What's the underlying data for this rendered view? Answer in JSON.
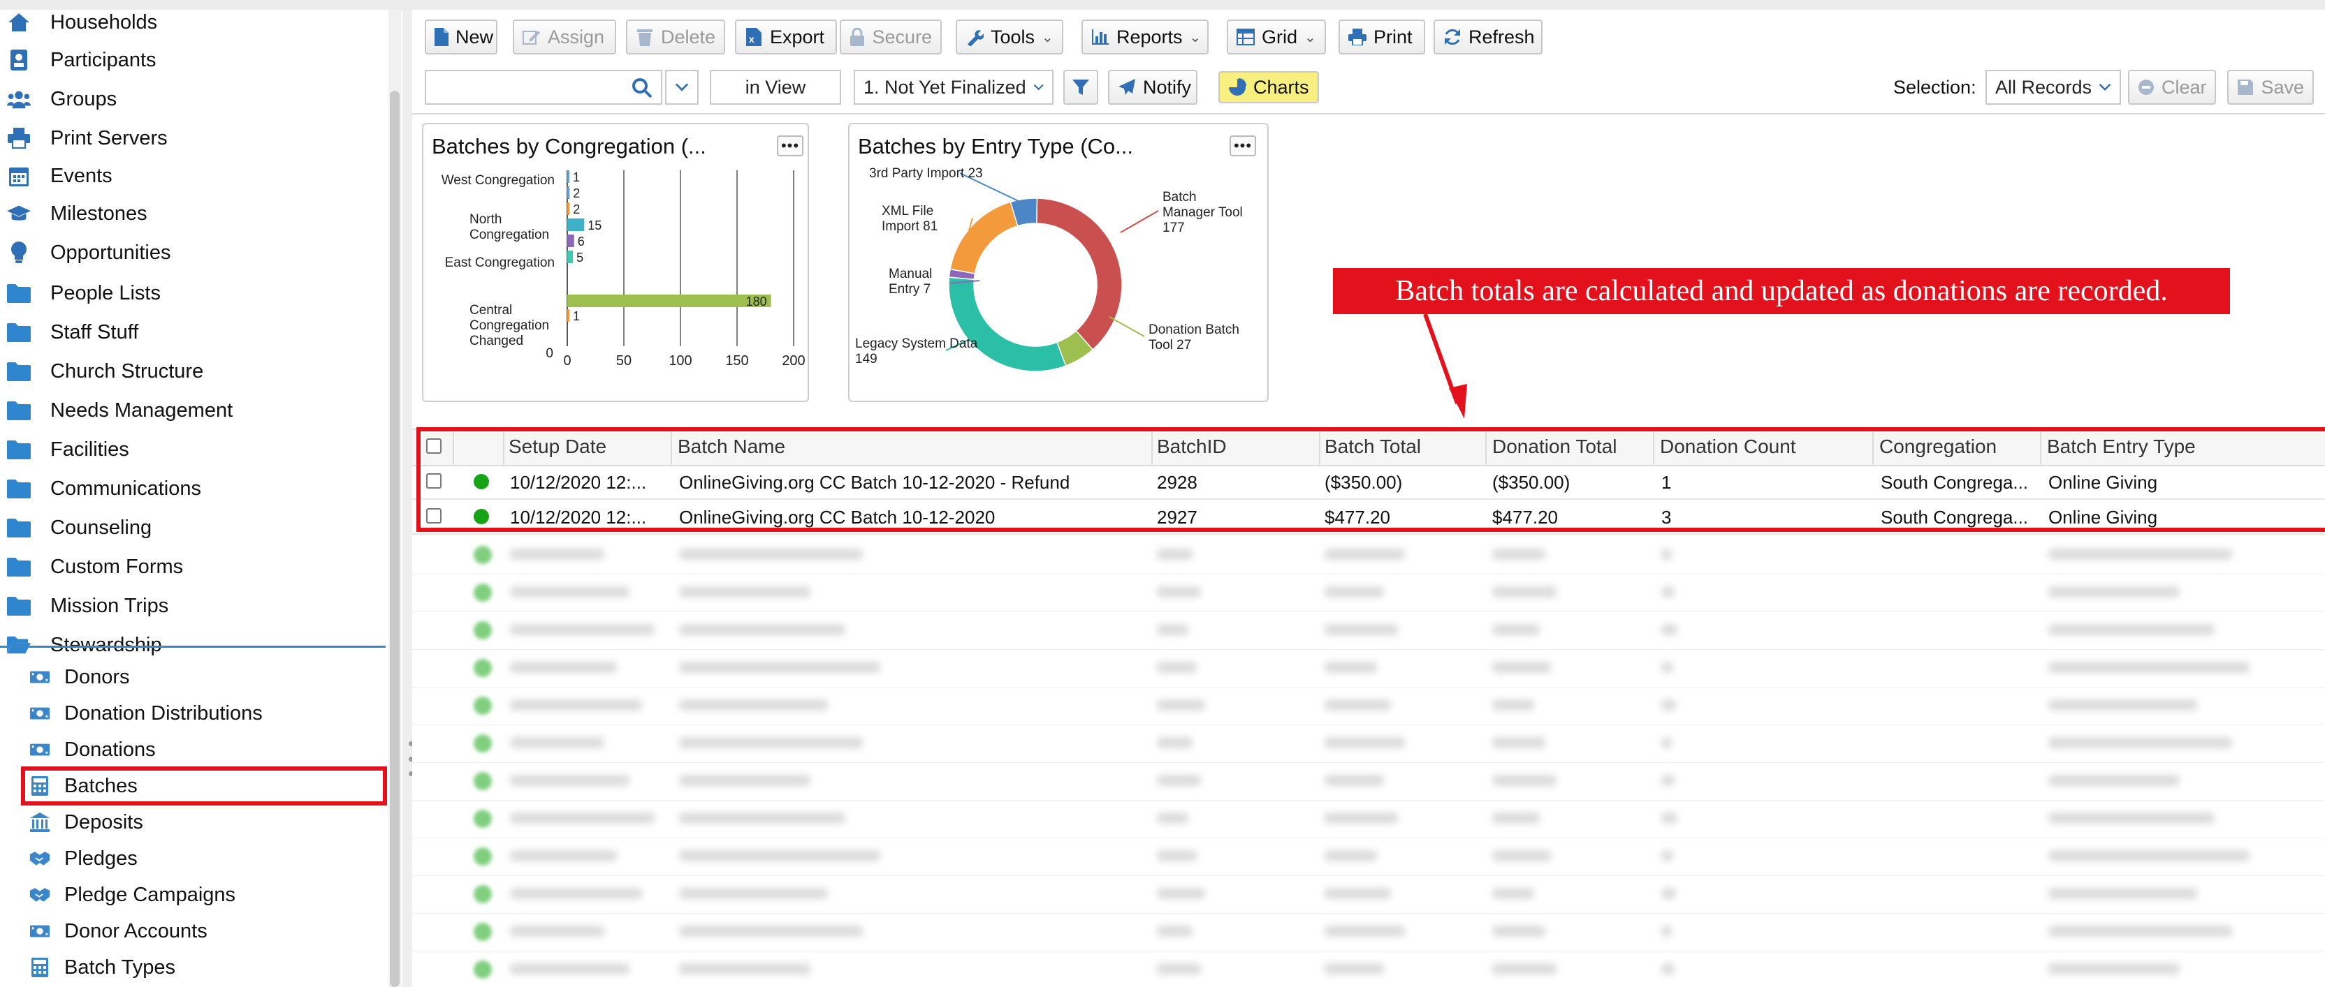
{
  "sidebar": {
    "items": [
      {
        "label": "Households",
        "icon": "house-icon"
      },
      {
        "label": "Participants",
        "icon": "id-badge-icon"
      },
      {
        "label": "Groups",
        "icon": "users-icon"
      },
      {
        "label": "Print Servers",
        "icon": "printer-icon"
      },
      {
        "label": "Events",
        "icon": "calendar-icon"
      },
      {
        "label": "Milestones",
        "icon": "graduation-cap-icon"
      },
      {
        "label": "Opportunities",
        "icon": "lightbulb-icon"
      },
      {
        "label": "People Lists",
        "icon": "folder-icon"
      },
      {
        "label": "Staff Stuff",
        "icon": "folder-icon"
      },
      {
        "label": "Church Structure",
        "icon": "folder-icon"
      },
      {
        "label": "Needs Management",
        "icon": "folder-icon"
      },
      {
        "label": "Facilities",
        "icon": "folder-icon"
      },
      {
        "label": "Communications",
        "icon": "folder-icon"
      },
      {
        "label": "Counseling",
        "icon": "folder-icon"
      },
      {
        "label": "Custom Forms",
        "icon": "folder-icon"
      },
      {
        "label": "Mission Trips",
        "icon": "folder-icon"
      },
      {
        "label": "Stewardship",
        "icon": "folder-open-icon"
      }
    ],
    "subitems": [
      {
        "label": "Donors",
        "icon": "money-icon"
      },
      {
        "label": "Donation Distributions",
        "icon": "money-icon"
      },
      {
        "label": "Donations",
        "icon": "money-icon"
      },
      {
        "label": "Batches",
        "icon": "calculator-icon",
        "selected": true
      },
      {
        "label": "Deposits",
        "icon": "bank-icon"
      },
      {
        "label": "Pledges",
        "icon": "handshake-icon"
      },
      {
        "label": "Pledge Campaigns",
        "icon": "handshake-icon"
      },
      {
        "label": "Donor Accounts",
        "icon": "money-icon"
      },
      {
        "label": "Batch Types",
        "icon": "calculator-icon"
      }
    ]
  },
  "toolbar": {
    "new": "New",
    "assign": "Assign",
    "delete": "Delete",
    "export": "Export",
    "secure": "Secure",
    "tools": "Tools",
    "reports": "Reports",
    "grid": "Grid",
    "print": "Print",
    "refresh": "Refresh"
  },
  "filterbar": {
    "search_value": "",
    "scope": "in View",
    "view": "1. Not Yet Finalized",
    "notify": "Notify",
    "charts": "Charts",
    "selection_label": "Selection:",
    "selection_value": "All Records",
    "clear": "Clear",
    "save": "Save"
  },
  "charts": {
    "congregation_title": "Batches by Congregation (...",
    "entry_type_title": "Batches by Entry Type (Co...",
    "menu_glyph": "•••"
  },
  "chart_data": [
    {
      "type": "bar",
      "orientation": "horizontal",
      "title": "Batches by Congregation (...",
      "categories": [
        "West Congregation",
        "",
        "North Congregation",
        "",
        "East Congregation",
        "",
        "Central Congregation Changed",
        ""
      ],
      "category_labels_shown": [
        "West Congregation",
        "North Congregation",
        "East Congregation",
        "Central Congregation Changed",
        "0"
      ],
      "values": [
        1,
        2,
        2,
        15,
        6,
        5,
        180,
        1
      ],
      "colors": [
        "#6a9fd4",
        "#6a9fd4",
        "#f29a3c",
        "#3fb0c8",
        "#8e68b8",
        "#3ec9b0",
        "#9cbf4f",
        "#f29a3c"
      ],
      "xlim": [
        0,
        200
      ],
      "xticks": [
        0,
        50,
        100,
        150,
        200
      ],
      "grid": true
    },
    {
      "type": "pie",
      "donut": true,
      "title": "Batches by Entry Type (Co...",
      "slices": [
        {
          "label": "Batch Manager Tool",
          "value": 177,
          "color": "#c9504f"
        },
        {
          "label": "Donation Batch Tool",
          "value": 27,
          "color": "#9cbf4f"
        },
        {
          "label": "Legacy System Data",
          "value": 149,
          "color": "#2bbfa8"
        },
        {
          "label": "Manual Entry",
          "value": 7,
          "color": "#8e68b8"
        },
        {
          "label": "XML File Import",
          "value": 81,
          "color": "#f29a3c"
        },
        {
          "label": "3rd Party Import",
          "value": 23,
          "color": "#4c86c6"
        }
      ]
    }
  ],
  "grid": {
    "columns": [
      "Setup Date",
      "Batch Name",
      "BatchID",
      "Batch Total",
      "Donation Total",
      "Donation Count",
      "Congregation",
      "Batch Entry Type"
    ],
    "rows": [
      {
        "setup_date": "10/12/2020 12:...",
        "batch_name": "OnlineGiving.org CC Batch 10-12-2020 - Refund",
        "batch_id": "2928",
        "batch_total": "($350.00)",
        "donation_total": "($350.00)",
        "donation_count": "1",
        "congregation": "South Congrega...",
        "entry_type": "Online Giving",
        "status_color": "#16a316"
      },
      {
        "setup_date": "10/12/2020 12:...",
        "batch_name": "OnlineGiving.org CC Batch 10-12-2020",
        "batch_id": "2927",
        "batch_total": "$477.20",
        "donation_total": "$477.20",
        "donation_count": "3",
        "congregation": "South Congrega...",
        "entry_type": "Online Giving",
        "status_color": "#16a316"
      }
    ]
  },
  "annotation": {
    "callout": "Batch totals are calculated and updated as donations are recorded.",
    "color": "#e3111b"
  }
}
